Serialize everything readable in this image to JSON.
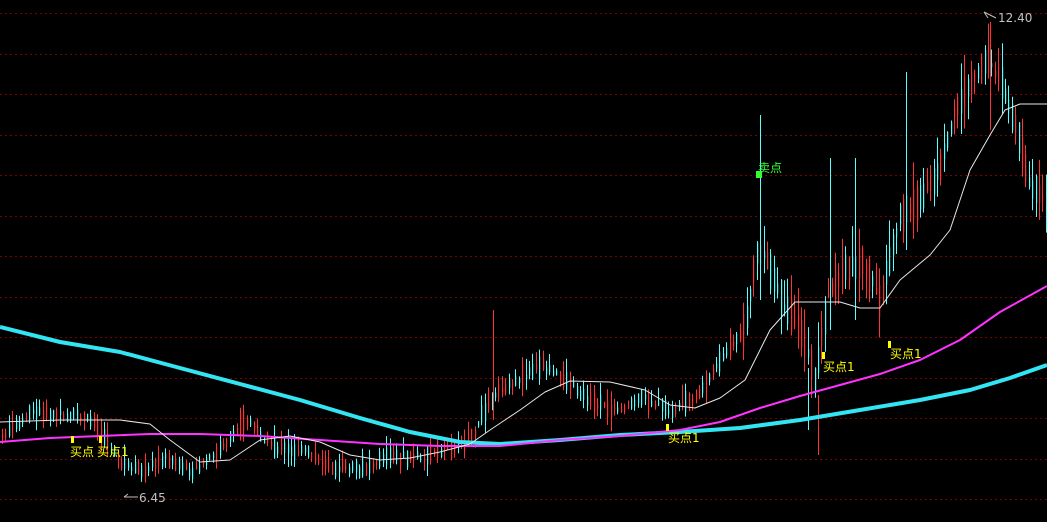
{
  "chart_data": {
    "type": "candlestick",
    "grid": true,
    "colors": {
      "background": "#000000",
      "grid": "#7a0000",
      "up_candle": "#ff3333",
      "down_candle": "#54ffff",
      "short_ma": "#e8e8e8",
      "mid_ma": "#ff33ff",
      "long_ma": "#33e5f2",
      "buy_marker": "#ffff00",
      "sell_marker": "#33ff33",
      "price_label": "#c0c0c0"
    },
    "y_range": [
      6.0,
      13.0
    ],
    "price_labels": {
      "high": "12.40",
      "low": "6.45"
    },
    "signal_labels": {
      "sell": "卖点",
      "buy": "买点",
      "buy1": "买点1"
    }
  }
}
